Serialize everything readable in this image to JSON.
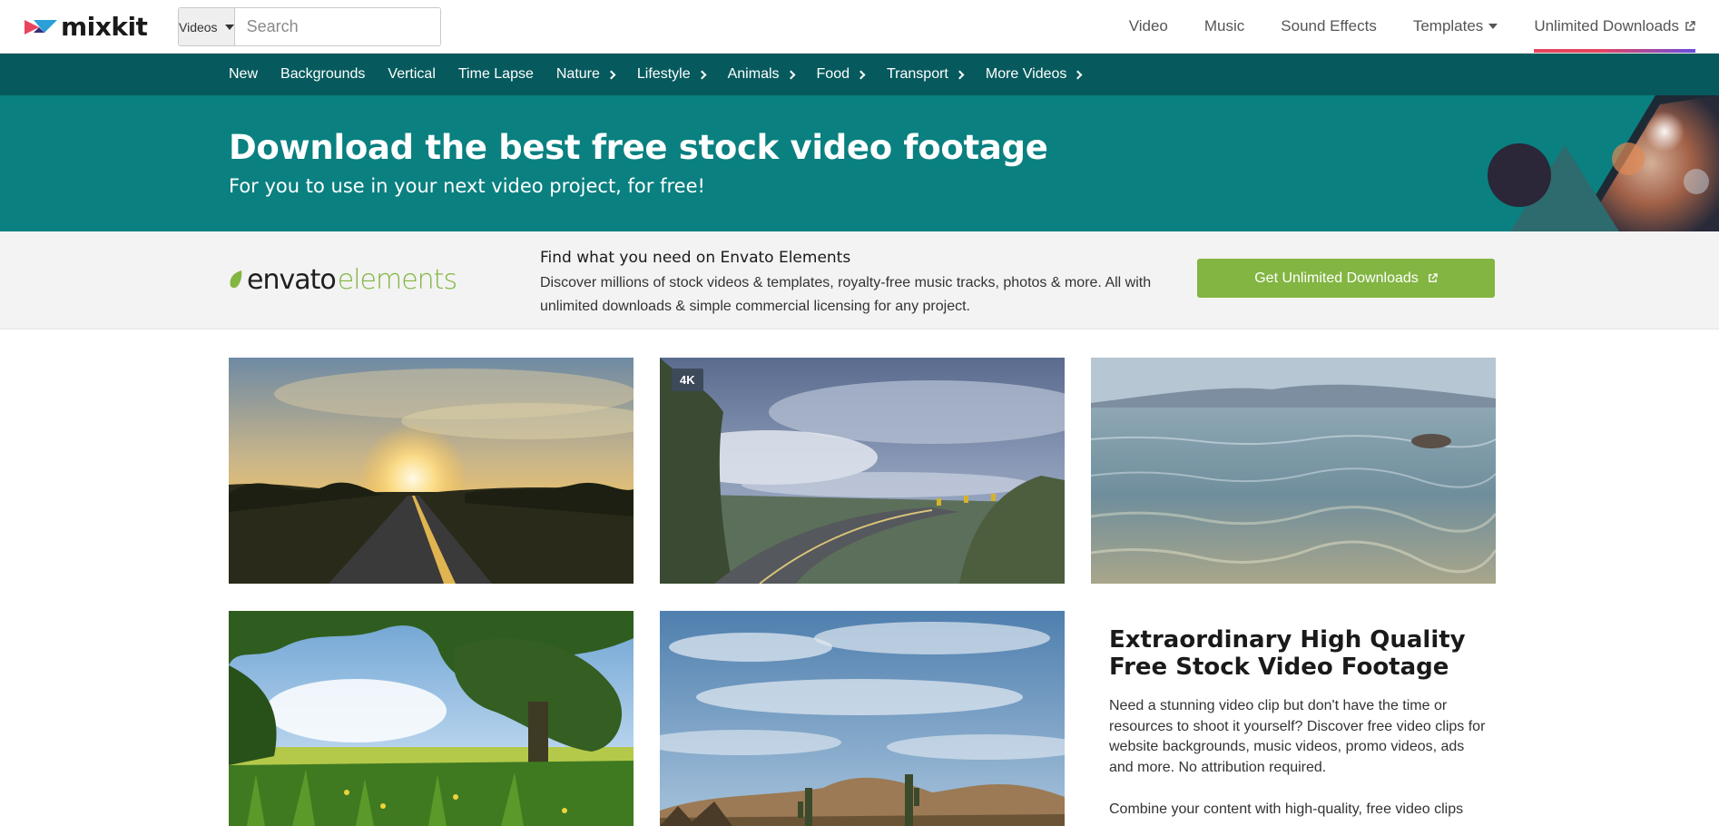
{
  "header": {
    "logo_text": "mixkit",
    "search": {
      "type_label": "Videos",
      "placeholder": "Search"
    },
    "nav": [
      {
        "label": "Video"
      },
      {
        "label": "Music"
      },
      {
        "label": "Sound Effects"
      },
      {
        "label": "Templates"
      },
      {
        "label": "Unlimited Downloads"
      }
    ]
  },
  "categories": [
    {
      "label": "New"
    },
    {
      "label": "Backgrounds"
    },
    {
      "label": "Vertical"
    },
    {
      "label": "Time Lapse"
    },
    {
      "label": "Nature"
    },
    {
      "label": "Lifestyle"
    },
    {
      "label": "Animals"
    },
    {
      "label": "Food"
    },
    {
      "label": "Transport"
    },
    {
      "label": "More Videos"
    }
  ],
  "hero": {
    "title": "Download the best free stock video footage",
    "subtitle": "For you to use in your next video project, for free!"
  },
  "promo": {
    "logo_left": "envato",
    "logo_right": "elements",
    "title": "Find what you need on Envato Elements",
    "text": "Discover millions of stock videos & templates, royalty-free music tracks, photos & more. All with unlimited downloads & simple commercial licensing for any project.",
    "button_label": "Get Unlimited Downloads"
  },
  "videos": [
    {
      "name": "sunset-road",
      "badge": ""
    },
    {
      "name": "mountain-curve-road",
      "badge": "4K"
    },
    {
      "name": "lake-water",
      "badge": ""
    },
    {
      "name": "green-field-tree",
      "badge": ""
    },
    {
      "name": "desert-cactus-sky",
      "badge": ""
    }
  ],
  "info": {
    "title": "Extraordinary High Quality Free Stock Video Footage",
    "p1": "Need a stunning video clip but don't have the time or resources to shoot it yourself? Discover free video clips for website backgrounds, music videos, promo videos, ads and more. No attribution required.",
    "p2": "Combine your content with high-quality, free video clips"
  },
  "colors": {
    "catnav_bg": "#065a5d",
    "hero_bg": "#0a8080",
    "envato_green": "#82b541",
    "unlimited_underline_start": "#e8445e",
    "unlimited_underline_end": "#6a4de0"
  },
  "icons": {
    "search": "magnifier-icon",
    "external": "external-link-icon",
    "chevron": "chevron-right-icon",
    "caret": "caret-down-icon"
  }
}
